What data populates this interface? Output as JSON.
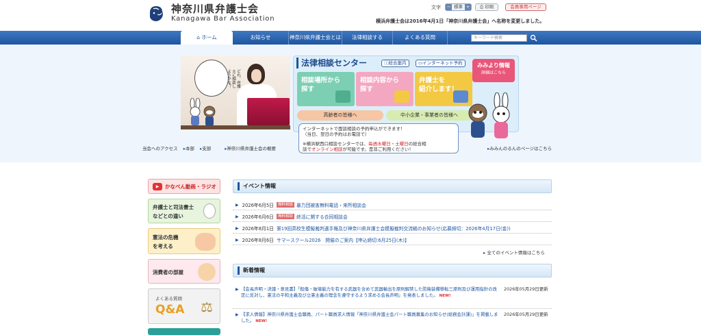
{
  "header": {
    "logo_ja": "神奈川県弁護士会",
    "logo_en": "Kanagawa Bar Association",
    "font_label": "文字",
    "font_minus": "−",
    "font_standard": "標準",
    "font_plus": "+",
    "print": "印刷",
    "member_page": "会員専用ページ",
    "notice": "横浜弁護士会は2016年4月1日「神奈川県弁護士会」へ名称を変更しました。"
  },
  "nav": {
    "items": [
      {
        "label": "ホーム"
      },
      {
        "label": "お知らせ"
      },
      {
        "label": "神奈川県弁護士会とは"
      },
      {
        "label": "法律相談する"
      },
      {
        "label": "よくある質問"
      },
      {
        "label": "よくある質問"
      }
    ],
    "home": "ホーム",
    "news": "お知らせ",
    "about": "神奈川県弁護士会とは",
    "consult": "法律相談する",
    "faq": "よくある質問",
    "search_placeholder": "キーワード検索"
  },
  "hero": {
    "bubble": "どれ、弁護士に相談しようかな？",
    "center_title": "法律相談センター",
    "overview": "総合案内",
    "net_booking": "インターネット予約",
    "mimiyori_title": "みみより情報",
    "mimiyori_link": "詳細はこちら",
    "tile1_line1": "相談場所から",
    "tile1_line2": "探す",
    "tile2_line1": "相談内容から",
    "tile2_line2": "探す",
    "tile3_line1": "弁護士を",
    "tile3_line2": "紹介します！",
    "elderly": "高齢者の皆様へ",
    "sme": "中小企業・事業者の皆様へ",
    "speech_l1": "インターネットで面談相談の予約申込ができます！",
    "speech_l2": "（当日、翌日の予約はお電話で）",
    "speech_l3a": "※横浜駅西口相談センターでは、",
    "speech_l3b": "毎週水曜日・土曜日",
    "speech_l3c": "の総合相",
    "speech_l4a": "談で",
    "speech_l4b": "オンライン相談",
    "speech_l4c": "が可能です。是非ご利用ください！",
    "access_label": "当会へのアクセス",
    "access_main": "本部",
    "access_branch": "支部",
    "overview_link": "神奈川県弁護士会の概要",
    "minna_link": "みみんのるんのページはこちら"
  },
  "sidebar": {
    "video": "かなべん動画・ラジオ",
    "diff_l1": "弁護士と司法書士",
    "diff_l2": "などとの違い",
    "constitution_l1": "憲法の危機",
    "constitution_l2": "を考える",
    "consumer": "消費者の部屋",
    "faq_small": "よくある質問",
    "faq_big": "Q&A"
  },
  "events": {
    "title": "イベント情報",
    "badge": "無料相談",
    "items": [
      {
        "date": "2026年6月5日",
        "badge": "無料相談",
        "text": "暴力団被害無料電話・来所相談会"
      },
      {
        "date": "2026年6月6日",
        "badge": "無料相談",
        "text": "終活に関する合同相談会"
      },
      {
        "date": "2026年8月1日",
        "badge": "",
        "text": "第19回高校生模擬裁判選手権及び神奈川県弁護士会模擬裁判交流戦のお知らせ(応募締切：2026年4月17日(金))"
      },
      {
        "date": "2026年8月6日",
        "badge": "",
        "text": "サマースクール2026　開催のご案内【申込締切:6月25日(木)】"
      }
    ],
    "more": "全てのイベント情報はこちら"
  },
  "news": {
    "title": "新着情報",
    "new_mark": "NEW!",
    "items": [
      {
        "text": "【会長声明・決議・意見書】「殺傷・破壊能力を有する武器を含めて武器輸出を原則解禁した防衛装備移転三原則及び運用指針の改定に反対し、憲法の平和主義及び立憲主義の理念を遵守するよう求める会長声明」を発表しました。",
        "date": "2026年05月29日更新"
      },
      {
        "text": "【求人情報】神奈川県弁護士会職員、パート職員求人情報「神奈川県弁護士会パート職員募集のお知らせ(総務会計課)」を掲載しました。",
        "date": "2026年05月29日更新"
      }
    ]
  },
  "colors": {
    "nav": "#1e55a0",
    "accent_pink": "#e9567a",
    "tile_green": "#7ccfb3",
    "tile_pink": "#f4a7c1",
    "tile_yellow": "#f3c944"
  }
}
